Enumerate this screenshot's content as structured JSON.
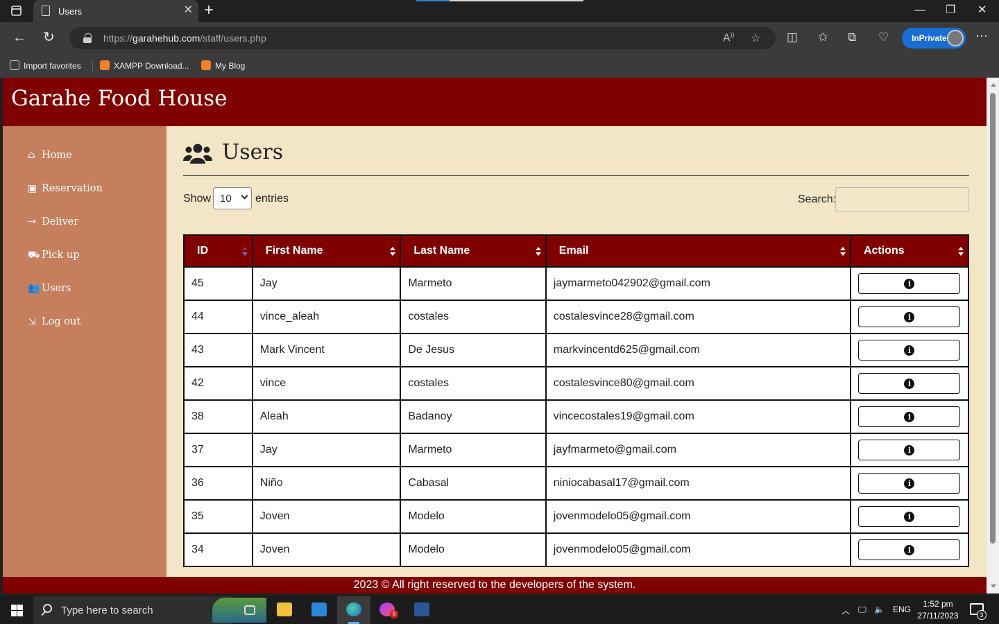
{
  "browser": {
    "tab_title": "Users",
    "tab_close": "✕",
    "new_tab": "+",
    "url_scheme": "https://",
    "url_host": "garahehub.com",
    "url_path": "/staff/users.php",
    "inprivate_label": "InPrivate",
    "favorites": [
      {
        "label": "Import favorites",
        "icon": "import-favorites-icon"
      },
      {
        "label": "XAMPP Download...",
        "icon": "xampp-icon"
      },
      {
        "label": "My Blog",
        "icon": "xampp-icon"
      }
    ],
    "window_controls": {
      "minimize": "—",
      "restore": "❐",
      "close": "✕"
    }
  },
  "site": {
    "brand": "Garahe Food House",
    "footer": "2023 © All right reserved to the developers of the system."
  },
  "sidebar": {
    "items": [
      {
        "label": "Home",
        "icon": "home-icon"
      },
      {
        "label": "Reservation",
        "icon": "address-card-icon"
      },
      {
        "label": "Deliver",
        "icon": "file-import-icon"
      },
      {
        "label": "Pick up",
        "icon": "truck-icon"
      },
      {
        "label": "Users",
        "icon": "users-icon"
      },
      {
        "label": "Log out",
        "icon": "sign-out-icon"
      }
    ]
  },
  "main": {
    "title": "Users",
    "length_label_before": "Show",
    "length_value": "10",
    "length_label_after": "entries",
    "search_label": "Search:",
    "search_value": ""
  },
  "table": {
    "columns": [
      "ID",
      "First Name",
      "Last Name",
      "Email",
      "Actions"
    ],
    "sorted_column": "ID",
    "sort_direction": "descending",
    "rows": [
      {
        "id": "45",
        "first": "Jay",
        "last": "Marmeto",
        "email": "jaymarmeto042902@gmail.com"
      },
      {
        "id": "44",
        "first": "vince_aleah",
        "last": "costales",
        "email": "costalesvince28@gmail.com"
      },
      {
        "id": "43",
        "first": "Mark Vincent",
        "last": "De Jesus",
        "email": "markvincentd625@gmail.com"
      },
      {
        "id": "42",
        "first": "vince",
        "last": "costales",
        "email": "costalesvince80@gmail.com"
      },
      {
        "id": "38",
        "first": "Aleah",
        "last": "Badanoy",
        "email": "vincecostales19@gmail.com"
      },
      {
        "id": "37",
        "first": "Jay",
        "last": "Marmeto",
        "email": "jayfmarmeto@gmail.com"
      },
      {
        "id": "36",
        "first": "Niño",
        "last": "Cabasal",
        "email": "niniocabasal17@gmail.com"
      },
      {
        "id": "35",
        "first": "Joven",
        "last": "Modelo",
        "email": "jovenmodelo05@gmail.com"
      },
      {
        "id": "34",
        "first": "Joven",
        "last": "Modelo",
        "email": "jovenmodelo05@gmail.com"
      }
    ],
    "action_icon": "info-circle-icon"
  },
  "taskbar": {
    "search_placeholder": "Type here to search",
    "language": "ENG",
    "time": "1:52 pm",
    "date": "27/11/2023",
    "messenger_badge": "8",
    "notification_count": "3"
  },
  "colors": {
    "header": "#800000",
    "sidebar": "#c57f5d",
    "page_bg": "#f2e6c6",
    "edge_accent": "#1a6ed1"
  }
}
